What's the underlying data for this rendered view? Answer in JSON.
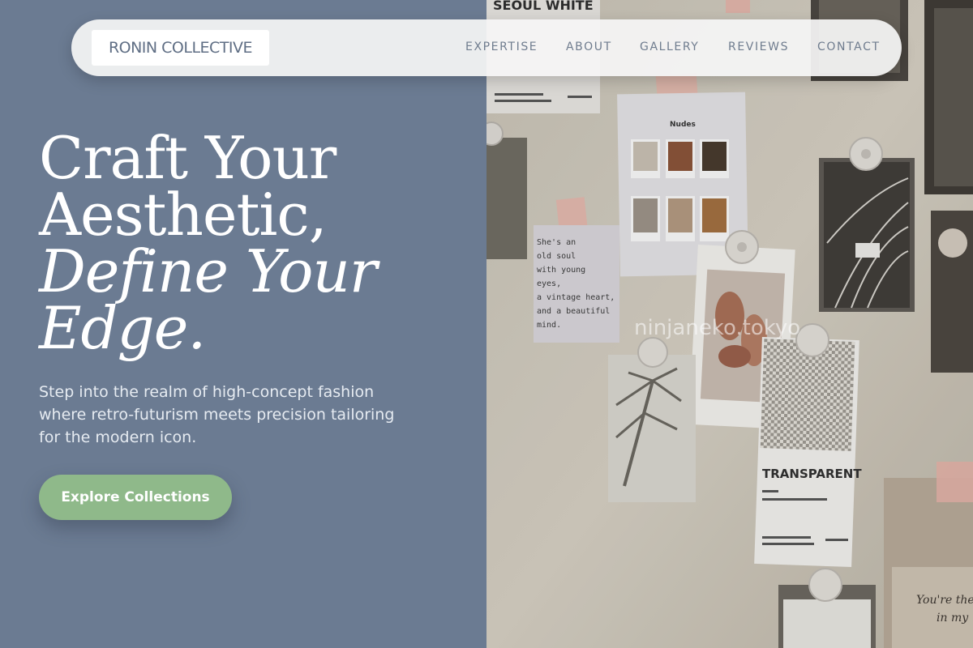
{
  "brand": {
    "name": "RONIN COLLECTIVE"
  },
  "nav": {
    "items": [
      {
        "label": "EXPERTISE"
      },
      {
        "label": "ABOUT"
      },
      {
        "label": "GALLERY"
      },
      {
        "label": "REVIEWS"
      },
      {
        "label": "CONTACT"
      }
    ]
  },
  "hero": {
    "headline_line1": "Craft Your",
    "headline_line2": "Aesthetic,",
    "headline_line3": "Define Your",
    "headline_line4": "Edge.",
    "subtext": "Step into the realm of high-concept fashion where retro-futurism meets precision tailoring for the modern icon.",
    "cta_label": "Explore Collections"
  },
  "photo": {
    "watermark": "ninjaneko.tokyo",
    "card_seoul_white": "SEOUL WHITE",
    "card_nudes_title": "Nudes",
    "note_text": [
      "She's an",
      "old soul",
      "with young",
      "eyes,",
      "a vintage heart,",
      "and a beautiful",
      "mind."
    ],
    "card_transparent": "TRANSPARENT",
    "handwriting": [
      "You're the",
      "in my"
    ]
  },
  "colors": {
    "panel_bg": "#6b7b92",
    "cta_bg": "#8fb98a",
    "nav_text": "#6f7c8e",
    "brand_text": "#5f6e84"
  }
}
